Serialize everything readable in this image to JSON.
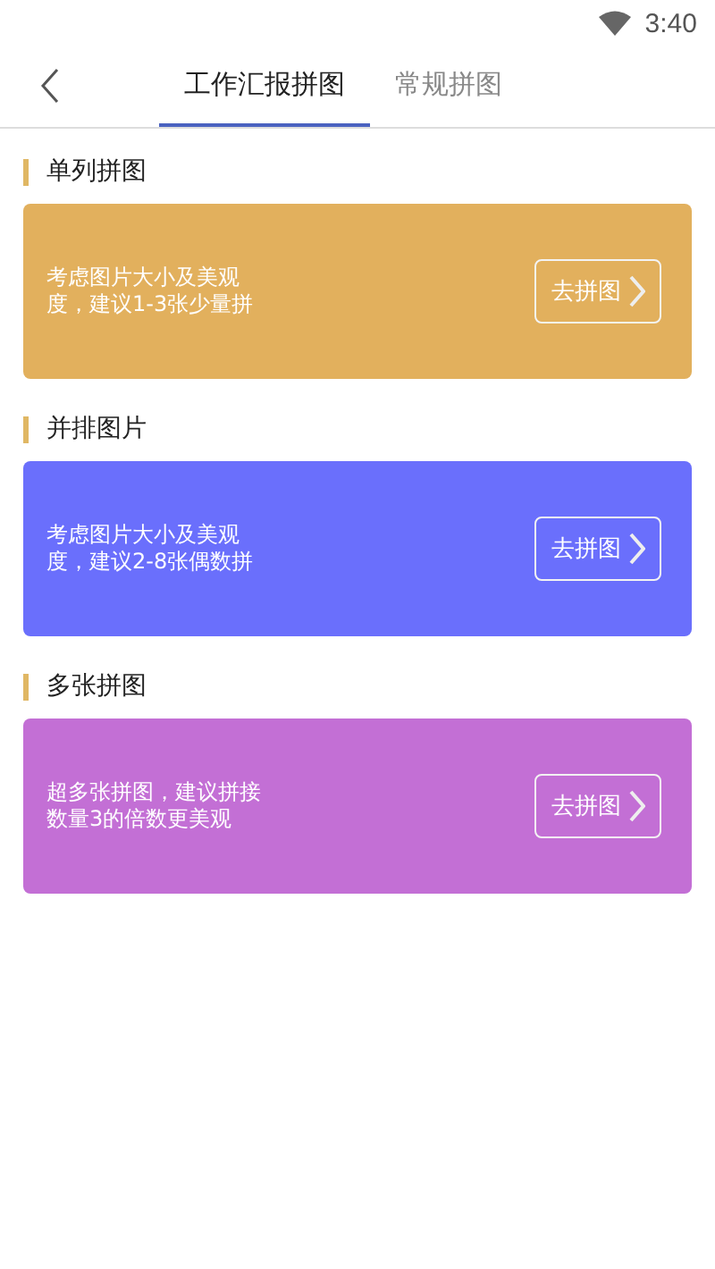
{
  "status_bar": {
    "time": "3:40"
  },
  "tabs": [
    {
      "label": "工作汇报拼图",
      "selected": true
    },
    {
      "label": "常规拼图",
      "selected": false
    }
  ],
  "sections": [
    {
      "title": "单列拼图",
      "color": "#e2b05d",
      "lines": [
        "考虑图片大小及美观",
        "度，建议1-3张少量拼"
      ],
      "button": "去拼图"
    },
    {
      "title": "并排图片",
      "color": "#6a6ffc",
      "lines": [
        "考虑图片大小及美观",
        "度，建议2-8张偶数拼"
      ],
      "button": "去拼图"
    },
    {
      "title": "多张拼图",
      "color": "#c36fd5",
      "lines": [
        "超多张拼图，建议拼接",
        "数量3的倍数更美观"
      ],
      "button": "去拼图"
    }
  ]
}
